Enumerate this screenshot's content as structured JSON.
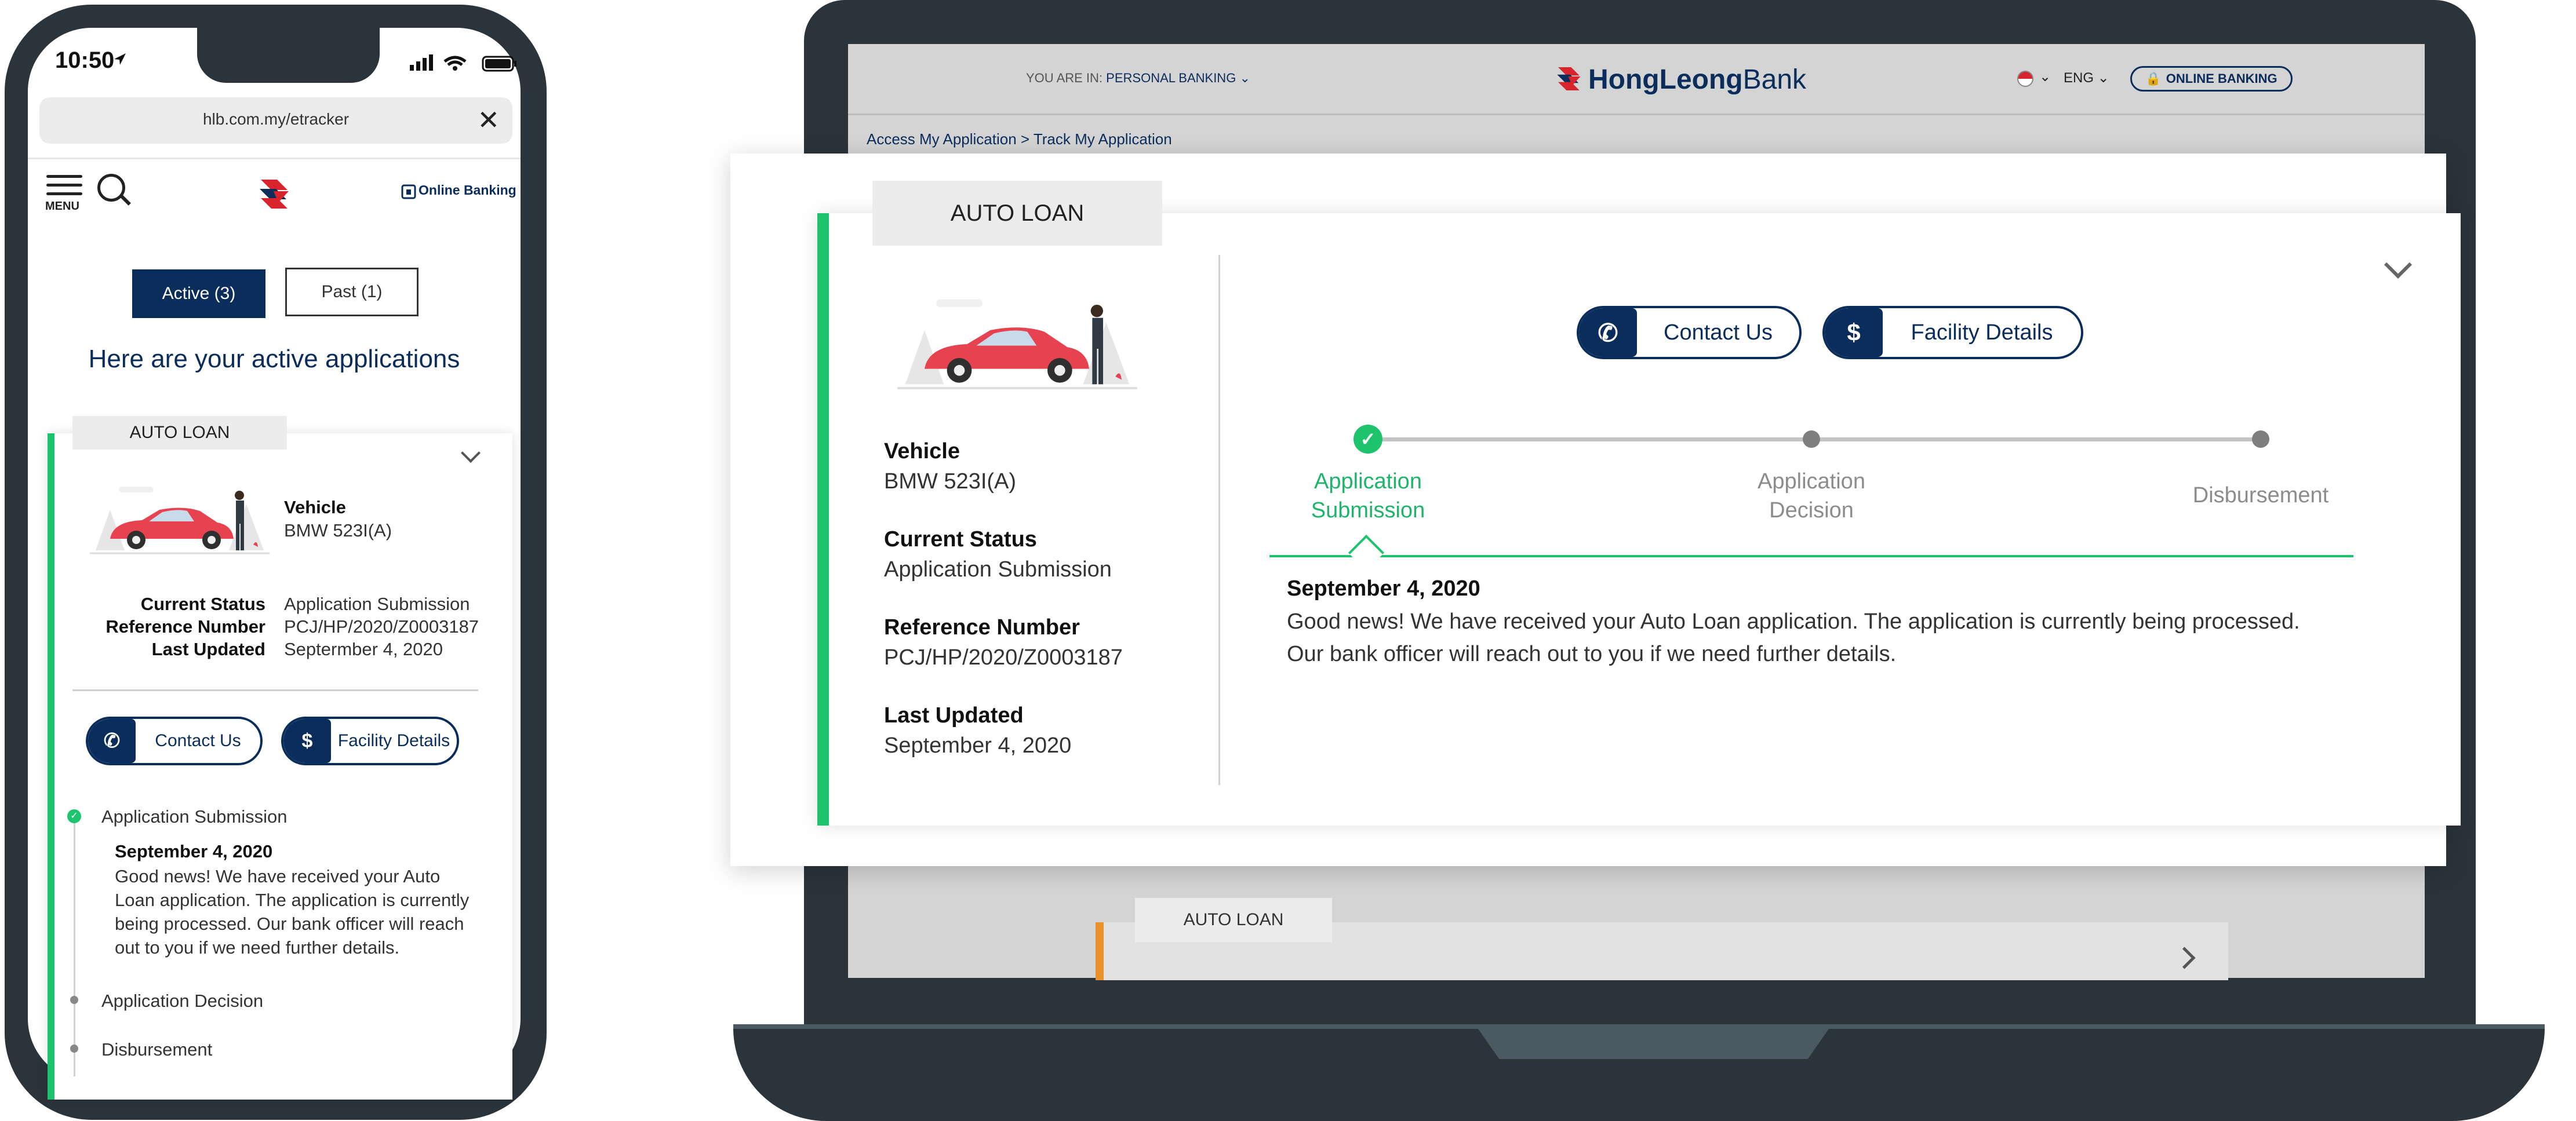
{
  "colors": {
    "brand_navy": "#0a2d5c",
    "active_green": "#1ec36d",
    "text_green": "#1eb46b",
    "inactive_grey": "#8c8c8c",
    "device_frame": "#2b343b"
  },
  "phone": {
    "status_time": "10:50",
    "url": "hlb.com.my/etracker",
    "menu_label": "MENU",
    "online_banking_label": "Online Banking",
    "tabs": [
      {
        "label": "Active (3)",
        "active": true
      },
      {
        "label": "Past (1)",
        "active": false
      }
    ],
    "heading": "Here are your active applications",
    "card": {
      "badge": "AUTO LOAN",
      "vehicle_label": "Vehicle",
      "vehicle_value": "BMW 523I(A)",
      "status_label": "Current Status",
      "status_value": "Application Submission",
      "ref_label": "Reference Number",
      "ref_value": "PCJ/HP/2020/Z0003187",
      "updated_label": "Last Updated",
      "updated_value": "Septermber 4, 2020",
      "contact_label": "Contact Us",
      "facility_label": "Facility Details",
      "timeline": [
        {
          "label": "Application Submission",
          "state": "done"
        },
        {
          "label": "Application Decision",
          "state": "pending"
        },
        {
          "label": "Disbursement",
          "state": "pending"
        }
      ],
      "message_date": "September 4, 2020",
      "message_text": "Good news! We have received your Auto Loan application. The application is currently being processed. Our bank officer will reach out to you if we need further details."
    }
  },
  "laptop": {
    "you_are_in_prefix": "YOU ARE IN:",
    "you_are_in_value": "PERSONAL BANKING",
    "brand_name_bold": "HongLeong",
    "brand_name_rest": "Bank",
    "language": "ENG",
    "online_banking_button": "ONLINE BANKING",
    "breadcrumb": "Access My Application > Track My Application",
    "lower_card_badge": "AUTO LOAN",
    "card": {
      "badge": "AUTO LOAN",
      "vehicle_label": "Vehicle",
      "vehicle_value": "BMW 523I(A)",
      "status_label": "Current Status",
      "status_value": "Application Submission",
      "ref_label": "Reference Number",
      "ref_value": "PCJ/HP/2020/Z0003187",
      "updated_label": "Last Updated",
      "updated_value": "September 4, 2020",
      "contact_label": "Contact Us",
      "facility_label": "Facility Details",
      "stages": [
        {
          "line1": "Application",
          "line2": "Submission",
          "state": "done"
        },
        {
          "line1": "Application",
          "line2": "Decision",
          "state": "pending"
        },
        {
          "line1": "Disbursement",
          "line2": "",
          "state": "pending"
        }
      ],
      "message_date": "September 4, 2020",
      "message_text": "Good news! We have received your Auto Loan application. The application is currently being processed. Our bank officer will reach out to you if we need further details."
    }
  }
}
